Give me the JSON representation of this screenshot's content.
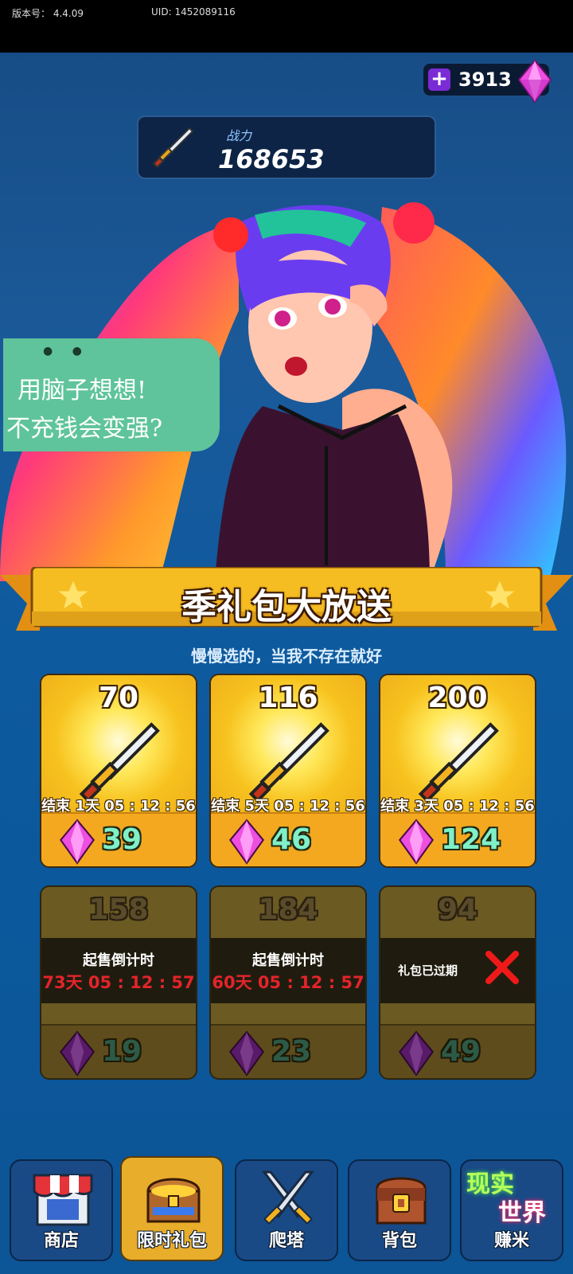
{
  "status_bar": {
    "version_label": "版本号：",
    "version": "4.4.09",
    "uid_label": "UID:",
    "uid": "1452089116"
  },
  "currency": {
    "amount": "3913",
    "add_icon": "plus-icon",
    "gem_icon": "pink-gem-icon"
  },
  "power": {
    "label": "战力",
    "value": "168653",
    "icon": "sword-icon"
  },
  "speech_bubble": {
    "line1": "用脑子想想!",
    "line2": "不充钱会变强?"
  },
  "banner": {
    "title": "季礼包大放送",
    "subtitle": "慢慢选的，当我不存在就好"
  },
  "packs": [
    {
      "amount": "70",
      "status": "结束 1天 05 : 12 : 56",
      "price": "39",
      "state": "available"
    },
    {
      "amount": "116",
      "status": "结束 5天 05 : 12 : 56",
      "price": "46",
      "state": "available"
    },
    {
      "amount": "200",
      "status": "结束 3天 05 : 12 : 56",
      "price": "124",
      "state": "available"
    },
    {
      "amount": "158",
      "status_title": "起售倒计时",
      "countdown": "73天 05 : 12 : 57",
      "price": "19",
      "state": "upcoming"
    },
    {
      "amount": "184",
      "status_title": "起售倒计时",
      "countdown": "60天 05 : 12 : 57",
      "price": "23",
      "state": "upcoming"
    },
    {
      "amount": "94",
      "status_title": "礼包已过期",
      "price": "49",
      "state": "expired"
    }
  ],
  "nav": {
    "items": [
      {
        "label": "商店",
        "icon": "shop-icon"
      },
      {
        "label": "限时礼包",
        "icon": "treasure-chest-icon",
        "active": true
      },
      {
        "label": "爬塔",
        "icon": "crossed-swords-icon"
      },
      {
        "label": "背包",
        "icon": "backpack-icon"
      },
      {
        "label": "赚米",
        "icon": "neon-sign-icon",
        "sign_line1": "现实",
        "sign_line2": "世界"
      }
    ]
  },
  "colors": {
    "background": "#0e5596",
    "card_gold": "#f2a623",
    "price_text": "#7ff0c8",
    "countdown_red": "#e3242b",
    "gem_pink": "#e53bd8"
  }
}
